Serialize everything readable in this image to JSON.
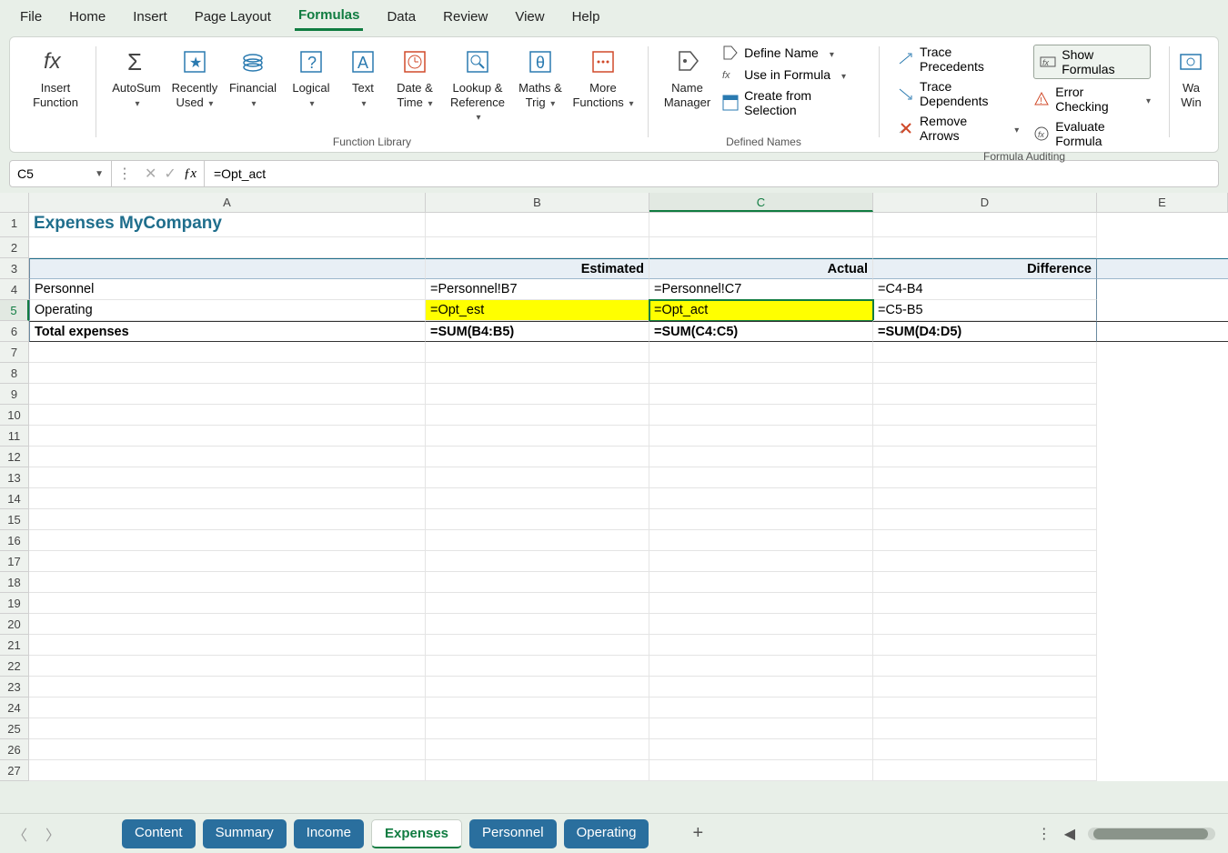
{
  "menu": [
    "File",
    "Home",
    "Insert",
    "Page Layout",
    "Formulas",
    "Data",
    "Review",
    "View",
    "Help"
  ],
  "menu_active": "Formulas",
  "ribbon": {
    "insert_function": {
      "label1": "Insert",
      "label2": "Function"
    },
    "library": {
      "autosum": "AutoSum",
      "recently": {
        "l1": "Recently",
        "l2": "Used"
      },
      "financial": "Financial",
      "logical": "Logical",
      "text": "Text",
      "datetime": {
        "l1": "Date &",
        "l2": "Time"
      },
      "lookup": {
        "l1": "Lookup &",
        "l2": "Reference"
      },
      "maths": {
        "l1": "Maths &",
        "l2": "Trig"
      },
      "more": {
        "l1": "More",
        "l2": "Functions"
      },
      "group_label": "Function Library"
    },
    "names": {
      "manager": {
        "l1": "Name",
        "l2": "Manager"
      },
      "define": "Define Name",
      "use": "Use in Formula",
      "create": "Create from Selection",
      "group_label": "Defined Names"
    },
    "audit": {
      "precedents": "Trace Precedents",
      "dependents": "Trace Dependents",
      "remove": "Remove Arrows",
      "show": "Show Formulas",
      "error": "Error Checking",
      "evaluate": "Evaluate Formula",
      "group_label": "Formula Auditing"
    },
    "watch": {
      "l1": "Wa",
      "l2": "Win"
    }
  },
  "name_box": "C5",
  "formula_input": "=Opt_act",
  "columns": [
    "A",
    "B",
    "C",
    "D",
    "E"
  ],
  "sheet": {
    "title": "Expenses MyCompany",
    "headers": {
      "b": "Estimated",
      "c": "Actual",
      "d": "Difference"
    },
    "rows": [
      {
        "a": "Personnel",
        "b": "=Personnel!B7",
        "c": "=Personnel!C7",
        "d": "=C4-B4"
      },
      {
        "a": "Operating",
        "b": "=Opt_est",
        "c": "=Opt_act",
        "d": "=C5-B5",
        "highlight": true
      },
      {
        "a": "Total expenses",
        "b": "=SUM(B4:B5)",
        "c": "=SUM(C4:C5)",
        "d": "=SUM(D4:D5)",
        "total": true
      }
    ]
  },
  "tabs": [
    "Content",
    "Summary",
    "Income",
    "Expenses",
    "Personnel",
    "Operating"
  ],
  "active_tab": "Expenses",
  "selected_cell": {
    "row": 5,
    "col": "C"
  }
}
